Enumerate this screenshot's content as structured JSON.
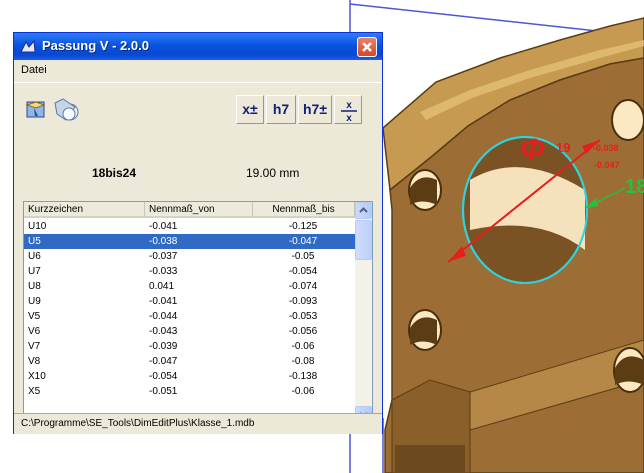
{
  "window": {
    "title": "Passung V - 2.0.0",
    "menu": [
      "Datei"
    ],
    "toolbar": {
      "btn_xpm": "x±",
      "btn_h7": "h7",
      "btn_h7pm": "h7±",
      "btn_frac": "x/x"
    },
    "info": {
      "range": "18bis24",
      "nominal": "19.00 mm"
    },
    "table": {
      "columns": [
        "Kurzzeichen",
        "Nennmaß_von",
        "Nennmaß_bis"
      ],
      "rows": [
        [
          "U10",
          "-0.041",
          "-0.125"
        ],
        [
          "U5",
          "-0.038",
          "-0.047"
        ],
        [
          "U6",
          "-0.037",
          "-0.05"
        ],
        [
          "U7",
          "-0.033",
          "-0.054"
        ],
        [
          "U8",
          "0.041",
          "-0.074"
        ],
        [
          "U9",
          "-0.041",
          "-0.093"
        ],
        [
          "V5",
          "-0.044",
          "-0.053"
        ],
        [
          "V6",
          "-0.043",
          "-0.056"
        ],
        [
          "V7",
          "-0.039",
          "-0.06"
        ],
        [
          "V8",
          "-0.047",
          "-0.08"
        ],
        [
          "X10",
          "-0.054",
          "-0.138"
        ],
        [
          "X5",
          "-0.051",
          "-0.06"
        ]
      ],
      "selected_index": 1
    },
    "status": "C:\\Programme\\SE_Tools\\DimEditPlus\\Klasse_1.mdb"
  },
  "cad": {
    "dimension": {
      "symbol": "Φ",
      "value": "19",
      "tol_upper": "-0.038",
      "tol_lower": "-0.047"
    },
    "side_label": "18"
  },
  "colors": {
    "titlebar": "#0a54e0",
    "selection": "#316ac5",
    "part": "#9c6e35",
    "dimension": "#e32020",
    "edge_highlight": "#2dd4e0"
  }
}
